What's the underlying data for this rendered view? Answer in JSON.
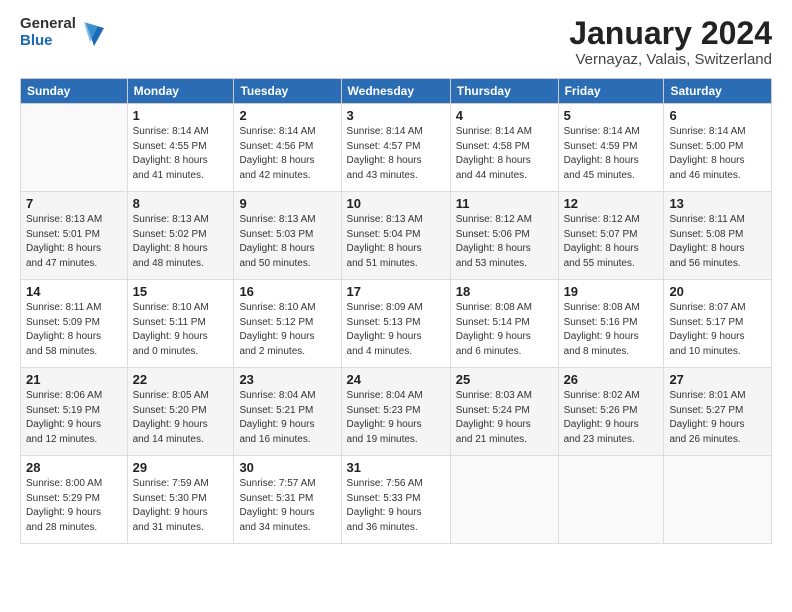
{
  "logo": {
    "text_general": "General",
    "text_blue": "Blue"
  },
  "header": {
    "month_title": "January 2024",
    "location": "Vernayaz, Valais, Switzerland"
  },
  "weekdays": [
    "Sunday",
    "Monday",
    "Tuesday",
    "Wednesday",
    "Thursday",
    "Friday",
    "Saturday"
  ],
  "weeks": [
    {
      "days": [
        {
          "num": "",
          "info": "",
          "empty": true
        },
        {
          "num": "1",
          "info": "Sunrise: 8:14 AM\nSunset: 4:55 PM\nDaylight: 8 hours\nand 41 minutes."
        },
        {
          "num": "2",
          "info": "Sunrise: 8:14 AM\nSunset: 4:56 PM\nDaylight: 8 hours\nand 42 minutes."
        },
        {
          "num": "3",
          "info": "Sunrise: 8:14 AM\nSunset: 4:57 PM\nDaylight: 8 hours\nand 43 minutes."
        },
        {
          "num": "4",
          "info": "Sunrise: 8:14 AM\nSunset: 4:58 PM\nDaylight: 8 hours\nand 44 minutes."
        },
        {
          "num": "5",
          "info": "Sunrise: 8:14 AM\nSunset: 4:59 PM\nDaylight: 8 hours\nand 45 minutes."
        },
        {
          "num": "6",
          "info": "Sunrise: 8:14 AM\nSunset: 5:00 PM\nDaylight: 8 hours\nand 46 minutes."
        }
      ]
    },
    {
      "days": [
        {
          "num": "7",
          "info": "Sunrise: 8:13 AM\nSunset: 5:01 PM\nDaylight: 8 hours\nand 47 minutes."
        },
        {
          "num": "8",
          "info": "Sunrise: 8:13 AM\nSunset: 5:02 PM\nDaylight: 8 hours\nand 48 minutes."
        },
        {
          "num": "9",
          "info": "Sunrise: 8:13 AM\nSunset: 5:03 PM\nDaylight: 8 hours\nand 50 minutes."
        },
        {
          "num": "10",
          "info": "Sunrise: 8:13 AM\nSunset: 5:04 PM\nDaylight: 8 hours\nand 51 minutes."
        },
        {
          "num": "11",
          "info": "Sunrise: 8:12 AM\nSunset: 5:06 PM\nDaylight: 8 hours\nand 53 minutes."
        },
        {
          "num": "12",
          "info": "Sunrise: 8:12 AM\nSunset: 5:07 PM\nDaylight: 8 hours\nand 55 minutes."
        },
        {
          "num": "13",
          "info": "Sunrise: 8:11 AM\nSunset: 5:08 PM\nDaylight: 8 hours\nand 56 minutes."
        }
      ]
    },
    {
      "days": [
        {
          "num": "14",
          "info": "Sunrise: 8:11 AM\nSunset: 5:09 PM\nDaylight: 8 hours\nand 58 minutes."
        },
        {
          "num": "15",
          "info": "Sunrise: 8:10 AM\nSunset: 5:11 PM\nDaylight: 9 hours\nand 0 minutes."
        },
        {
          "num": "16",
          "info": "Sunrise: 8:10 AM\nSunset: 5:12 PM\nDaylight: 9 hours\nand 2 minutes."
        },
        {
          "num": "17",
          "info": "Sunrise: 8:09 AM\nSunset: 5:13 PM\nDaylight: 9 hours\nand 4 minutes."
        },
        {
          "num": "18",
          "info": "Sunrise: 8:08 AM\nSunset: 5:14 PM\nDaylight: 9 hours\nand 6 minutes."
        },
        {
          "num": "19",
          "info": "Sunrise: 8:08 AM\nSunset: 5:16 PM\nDaylight: 9 hours\nand 8 minutes."
        },
        {
          "num": "20",
          "info": "Sunrise: 8:07 AM\nSunset: 5:17 PM\nDaylight: 9 hours\nand 10 minutes."
        }
      ]
    },
    {
      "days": [
        {
          "num": "21",
          "info": "Sunrise: 8:06 AM\nSunset: 5:19 PM\nDaylight: 9 hours\nand 12 minutes."
        },
        {
          "num": "22",
          "info": "Sunrise: 8:05 AM\nSunset: 5:20 PM\nDaylight: 9 hours\nand 14 minutes."
        },
        {
          "num": "23",
          "info": "Sunrise: 8:04 AM\nSunset: 5:21 PM\nDaylight: 9 hours\nand 16 minutes."
        },
        {
          "num": "24",
          "info": "Sunrise: 8:04 AM\nSunset: 5:23 PM\nDaylight: 9 hours\nand 19 minutes."
        },
        {
          "num": "25",
          "info": "Sunrise: 8:03 AM\nSunset: 5:24 PM\nDaylight: 9 hours\nand 21 minutes."
        },
        {
          "num": "26",
          "info": "Sunrise: 8:02 AM\nSunset: 5:26 PM\nDaylight: 9 hours\nand 23 minutes."
        },
        {
          "num": "27",
          "info": "Sunrise: 8:01 AM\nSunset: 5:27 PM\nDaylight: 9 hours\nand 26 minutes."
        }
      ]
    },
    {
      "days": [
        {
          "num": "28",
          "info": "Sunrise: 8:00 AM\nSunset: 5:29 PM\nDaylight: 9 hours\nand 28 minutes."
        },
        {
          "num": "29",
          "info": "Sunrise: 7:59 AM\nSunset: 5:30 PM\nDaylight: 9 hours\nand 31 minutes."
        },
        {
          "num": "30",
          "info": "Sunrise: 7:57 AM\nSunset: 5:31 PM\nDaylight: 9 hours\nand 34 minutes."
        },
        {
          "num": "31",
          "info": "Sunrise: 7:56 AM\nSunset: 5:33 PM\nDaylight: 9 hours\nand 36 minutes."
        },
        {
          "num": "",
          "info": "",
          "empty": true
        },
        {
          "num": "",
          "info": "",
          "empty": true
        },
        {
          "num": "",
          "info": "",
          "empty": true
        }
      ]
    }
  ]
}
